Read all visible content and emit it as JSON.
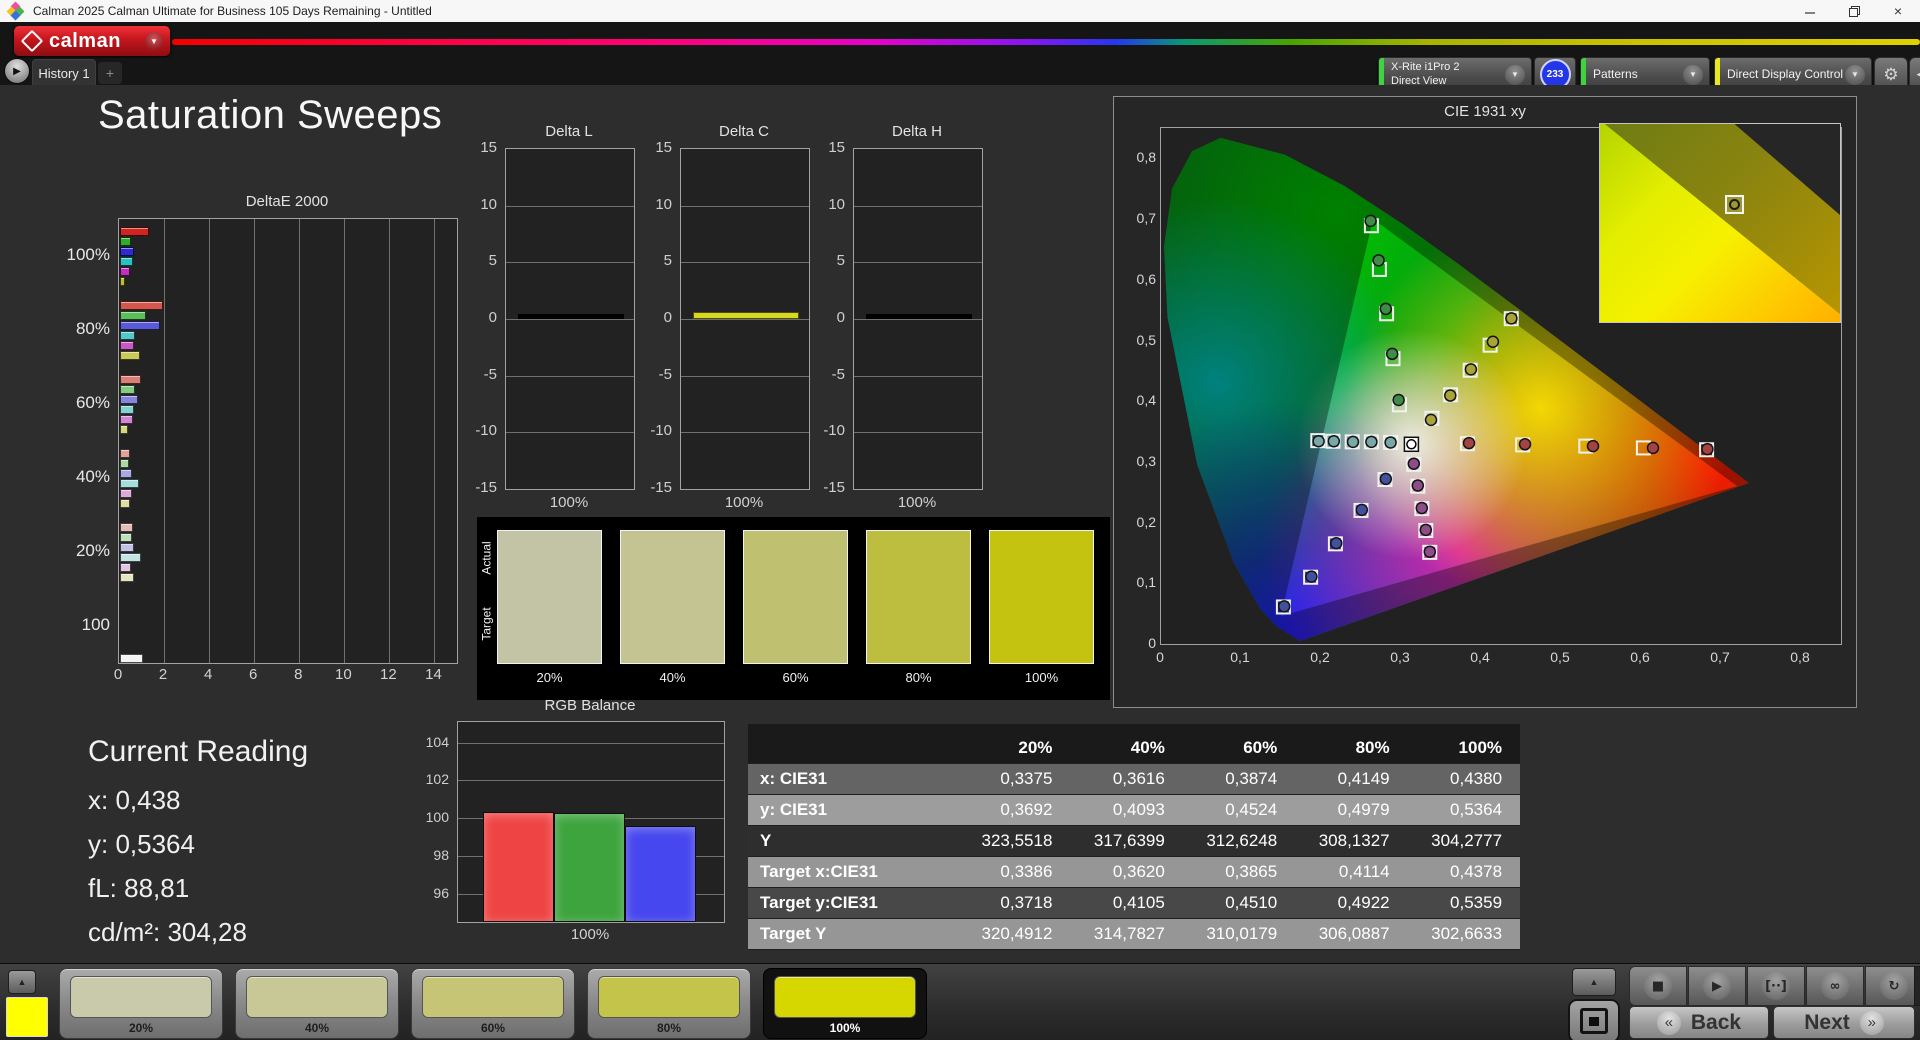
{
  "window": {
    "title": "Calman 2025 Calman Ultimate for Business 105 Days Remaining  - Untitled"
  },
  "header": {
    "logo": "calman"
  },
  "tab_bar": {
    "history_tab": "History 1",
    "add_tab": "+"
  },
  "toolbar": {
    "meter_line1": "X-Rite i1Pro 2",
    "meter_line2": "Direct View",
    "meter_badge": "233",
    "patterns_label": "Patterns",
    "display_control_label": "Direct Display Control",
    "gear": "⚙",
    "collapse": "◀"
  },
  "page_title": "Saturation Sweeps",
  "current_reading": {
    "title": "Current Reading",
    "lines": [
      "x: 0,438",
      "y: 0,5364",
      "fL: 88,81",
      "cd/m²: 304,28"
    ]
  },
  "bottom_bar": {
    "pattern_chip_color": "#ffff00",
    "patterns": [
      {
        "label": "20%",
        "color": "#c9c9ab",
        "selected": false
      },
      {
        "label": "40%",
        "color": "#c8c896",
        "selected": false
      },
      {
        "label": "60%",
        "color": "#c5c575",
        "selected": false
      },
      {
        "label": "80%",
        "color": "#c4c44a",
        "selected": false
      },
      {
        "label": "100%",
        "color": "#d6d600",
        "selected": true
      }
    ],
    "transport": [
      {
        "name": "stop-button",
        "glyph": "■"
      },
      {
        "name": "play-button",
        "glyph": "▶"
      },
      {
        "name": "step-button",
        "glyph": "[··]"
      },
      {
        "name": "loop-button",
        "glyph": "∞"
      },
      {
        "name": "refresh-button",
        "glyph": "↻"
      }
    ],
    "back": "Back",
    "next": "Next"
  },
  "chart_data": [
    {
      "id": "deltae2000",
      "type": "bar",
      "orientation": "horizontal",
      "title": "DeltaE 2000",
      "xlim": [
        0,
        15
      ],
      "xticks": [
        0,
        2,
        4,
        6,
        8,
        10,
        12,
        14
      ],
      "series_names": [
        "Red",
        "Green",
        "Blue",
        "Cyan",
        "Magenta",
        "Yellow"
      ],
      "groups": [
        {
          "label": "100%",
          "values": [
            1.2,
            0.4,
            0.55,
            0.5,
            0.35,
            0.15
          ],
          "colors": [
            "#cf2420",
            "#2fae2c",
            "#2b2bd0",
            "#28c0c0",
            "#c02fc0",
            "#bebe28"
          ]
        },
        {
          "label": "80%",
          "values": [
            1.85,
            1.05,
            1.7,
            0.6,
            0.55,
            0.8
          ],
          "colors": [
            "#d4574e",
            "#5cbe58",
            "#5a5ad8",
            "#55c8c8",
            "#c85ac8",
            "#caca58"
          ]
        },
        {
          "label": "60%",
          "values": [
            0.85,
            0.6,
            0.7,
            0.55,
            0.5,
            0.25
          ],
          "colors": [
            "#d97f76",
            "#85cc80",
            "#8585de",
            "#82d2d2",
            "#d286d2",
            "#d6d680"
          ]
        },
        {
          "label": "40%",
          "values": [
            0.35,
            0.3,
            0.45,
            0.75,
            0.45,
            0.35
          ],
          "colors": [
            "#dfa29b",
            "#a8d8a4",
            "#a8a8e4",
            "#a6dcdc",
            "#dcaadc",
            "#dedea4"
          ]
        },
        {
          "label": "20%",
          "values": [
            0.5,
            0.45,
            0.55,
            0.85,
            0.4,
            0.55
          ],
          "colors": [
            "#e4bcb6",
            "#c0e0bc",
            "#c2c2e8",
            "#c2e4e4",
            "#e4c4e4",
            "#e6e6c0"
          ]
        },
        {
          "label": "100",
          "values": [
            0.95
          ],
          "colors": [
            "#f4f4f4"
          ]
        }
      ]
    },
    {
      "id": "delta_l",
      "type": "bar",
      "title": "Delta L",
      "ylim": [
        -15,
        15
      ],
      "yticks": [
        15,
        10,
        5,
        0,
        -5,
        -10,
        -15
      ],
      "categories": [
        "100%"
      ],
      "values": [
        0.1
      ],
      "bar_color": "#000000"
    },
    {
      "id": "delta_c",
      "type": "bar",
      "title": "Delta C",
      "ylim": [
        -15,
        15
      ],
      "yticks": [
        15,
        10,
        5,
        0,
        -5,
        -10,
        -15
      ],
      "categories": [
        "100%"
      ],
      "values": [
        0.4
      ],
      "bar_color": "#d8d820"
    },
    {
      "id": "delta_h",
      "type": "bar",
      "title": "Delta H",
      "ylim": [
        -15,
        15
      ],
      "yticks": [
        15,
        10,
        5,
        0,
        -5,
        -10,
        -15
      ],
      "categories": [
        "100%"
      ],
      "values": [
        0.05
      ],
      "bar_color": "#000000"
    },
    {
      "id": "saturation_swatches",
      "type": "table",
      "row_labels": [
        "Actual",
        "Target"
      ],
      "categories": [
        "20%",
        "40%",
        "60%",
        "80%",
        "100%"
      ],
      "colors": [
        "#c3c3a5",
        "#c4c492",
        "#c0c071",
        "#bdbd40",
        "#c3c310"
      ]
    },
    {
      "id": "cie1931",
      "type": "scatter",
      "title": "CIE 1931 xy",
      "xlim": [
        0,
        0.85
      ],
      "ylim": [
        0,
        0.85
      ],
      "xtick_labels": [
        "0",
        "0,1",
        "0,2",
        "0,3",
        "0,4",
        "0,5",
        "0,6",
        "0,7",
        "0,8"
      ],
      "ytick_labels": [
        "0",
        "0,1",
        "0,2",
        "0,3",
        "0,4",
        "0,5",
        "0,6",
        "0,7",
        "0,8"
      ],
      "white_point": [
        0.313,
        0.329
      ],
      "gamut_triangle": [
        [
          0.265,
          0.7
        ],
        [
          0.72,
          0.26
        ],
        [
          0.15,
          0.046
        ]
      ],
      "sweeps": [
        {
          "name": "Yellow",
          "dot_color": "#aaa23a",
          "measured": [
            [
              0.3375,
              0.3692
            ],
            [
              0.3616,
              0.4093
            ],
            [
              0.3874,
              0.4524
            ],
            [
              0.4149,
              0.4979
            ],
            [
              0.438,
              0.5364
            ]
          ],
          "targets": [
            [
              0.3386,
              0.3718
            ],
            [
              0.362,
              0.4105
            ],
            [
              0.3865,
              0.451
            ],
            [
              0.4114,
              0.4922
            ],
            [
              0.4378,
              0.5359
            ]
          ]
        },
        {
          "name": "Red",
          "dot_color": "#a34343",
          "measured": [
            [
              0.385,
              0.331
            ],
            [
              0.455,
              0.329
            ],
            [
              0.54,
              0.326
            ],
            [
              0.615,
              0.323
            ],
            [
              0.683,
              0.321
            ]
          ],
          "targets": [
            [
              0.383,
              0.33
            ],
            [
              0.452,
              0.328
            ],
            [
              0.531,
              0.326
            ],
            [
              0.603,
              0.323
            ],
            [
              0.682,
              0.32
            ]
          ]
        },
        {
          "name": "Green",
          "dot_color": "#3f8c46",
          "measured": [
            [
              0.297,
              0.402
            ],
            [
              0.289,
              0.478
            ],
            [
              0.281,
              0.552
            ],
            [
              0.272,
              0.632
            ],
            [
              0.262,
              0.697
            ]
          ],
          "targets": [
            [
              0.298,
              0.394
            ],
            [
              0.29,
              0.47
            ],
            [
              0.282,
              0.544
            ],
            [
              0.273,
              0.617
            ],
            [
              0.263,
              0.689
            ]
          ]
        },
        {
          "name": "Cyan",
          "dot_color": "#79a8a8",
          "measured": [
            [
              0.287,
              0.332
            ],
            [
              0.263,
              0.333
            ],
            [
              0.24,
              0.333
            ],
            [
              0.216,
              0.334
            ],
            [
              0.197,
              0.334
            ]
          ],
          "targets": [
            [
              0.287,
              0.332
            ],
            [
              0.263,
              0.333
            ],
            [
              0.239,
              0.333
            ],
            [
              0.215,
              0.334
            ],
            [
              0.196,
              0.335
            ]
          ]
        },
        {
          "name": "Magenta",
          "dot_color": "#8c4d88",
          "measured": [
            [
              0.316,
              0.297
            ],
            [
              0.321,
              0.261
            ],
            [
              0.326,
              0.224
            ],
            [
              0.331,
              0.188
            ],
            [
              0.336,
              0.152
            ]
          ],
          "targets": [
            [
              0.316,
              0.296
            ],
            [
              0.321,
              0.26
            ],
            [
              0.326,
              0.223
            ],
            [
              0.331,
              0.187
            ],
            [
              0.336,
              0.151
            ]
          ]
        },
        {
          "name": "Blue",
          "dot_color": "#41519c",
          "measured": [
            [
              0.281,
              0.272
            ],
            [
              0.251,
              0.221
            ],
            [
              0.219,
              0.166
            ],
            [
              0.188,
              0.111
            ],
            [
              0.154,
              0.062
            ]
          ],
          "targets": [
            [
              0.28,
              0.271
            ],
            [
              0.25,
              0.22
            ],
            [
              0.218,
              0.165
            ],
            [
              0.187,
              0.11
            ],
            [
              0.153,
              0.061
            ]
          ]
        }
      ],
      "inset_marker": [
        0.52,
        0.36
      ]
    },
    {
      "id": "rgb_balance",
      "type": "bar",
      "title": "RGB Balance",
      "categories": [
        "Red",
        "Green",
        "Blue"
      ],
      "values": [
        100.2,
        100.15,
        99.5
      ],
      "colors": [
        "#ef4444",
        "#3ea43e",
        "#4747ef"
      ],
      "ylim": [
        94.5,
        105.1
      ],
      "yticks": [
        104,
        102,
        100,
        98,
        96
      ],
      "xlabel": "100%"
    },
    {
      "id": "measurement_table",
      "type": "table",
      "columns": [
        "20%",
        "40%",
        "60%",
        "80%",
        "100%"
      ],
      "rows": [
        {
          "label": "x: CIE31",
          "values": [
            "0,3375",
            "0,3616",
            "0,3874",
            "0,4149",
            "0,4380"
          ],
          "bg": "#646464"
        },
        {
          "label": "y: CIE31",
          "values": [
            "0,3692",
            "0,4093",
            "0,4524",
            "0,4979",
            "0,5364"
          ],
          "bg": "#9d9d9d"
        },
        {
          "label": "Y",
          "values": [
            "323,5518",
            "317,6399",
            "312,6248",
            "308,1327",
            "304,2777"
          ],
          "bg": "#2e2e2e"
        },
        {
          "label": "Target x:CIE31",
          "values": [
            "0,3386",
            "0,3620",
            "0,3865",
            "0,4114",
            "0,4378"
          ],
          "bg": "#969696"
        },
        {
          "label": "Target y:CIE31",
          "values": [
            "0,3718",
            "0,4105",
            "0,4510",
            "0,4922",
            "0,5359"
          ],
          "bg": "#484848"
        },
        {
          "label": "Target Y",
          "values": [
            "320,4912",
            "314,7827",
            "310,0179",
            "306,0887",
            "302,6633"
          ],
          "bg": "#969696"
        }
      ]
    }
  ]
}
